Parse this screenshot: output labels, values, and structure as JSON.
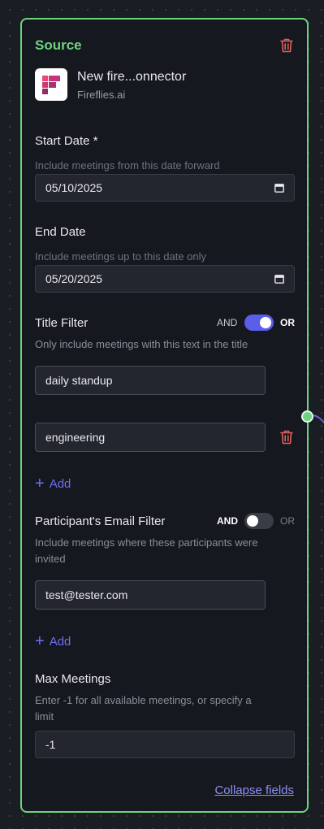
{
  "source": {
    "title": "Source",
    "delete_icon": "trash-icon",
    "connector": {
      "name": "New fire...onnector",
      "provider": "Fireflies.ai",
      "logo_icon": "fireflies-logo"
    }
  },
  "fields": {
    "start_date": {
      "label": "Start Date *",
      "help": "Include meetings from this date forward",
      "value": "05/10/2025"
    },
    "end_date": {
      "label": "End Date",
      "help": "Include meetings up to this date only",
      "value": "05/20/2025"
    },
    "title_filter": {
      "label": "Title Filter",
      "toggle_and": "AND",
      "toggle_or": "OR",
      "toggle_state": "OR",
      "help": "Only include meetings with this text in the title",
      "values": [
        "daily standup",
        "engineering"
      ],
      "add_label": "Add"
    },
    "participant_filter": {
      "label": "Participant's Email Filter",
      "toggle_and": "AND",
      "toggle_or": "OR",
      "toggle_state": "AND",
      "help_line1": "Include meetings where these participants were",
      "help_line2": "invited",
      "values": [
        "test@tester.com"
      ],
      "add_label": "Add"
    },
    "max_meetings": {
      "label": "Max Meetings",
      "help_line1": "Enter -1 for all available meetings, or specify a",
      "help_line2": "limit",
      "value": "-1"
    }
  },
  "collapse_label": "Collapse fields",
  "colors": {
    "card_border": "#6dd47e",
    "accent": "#5a5ee8",
    "danger": "#e0605e",
    "link": "#8e8ff4"
  }
}
